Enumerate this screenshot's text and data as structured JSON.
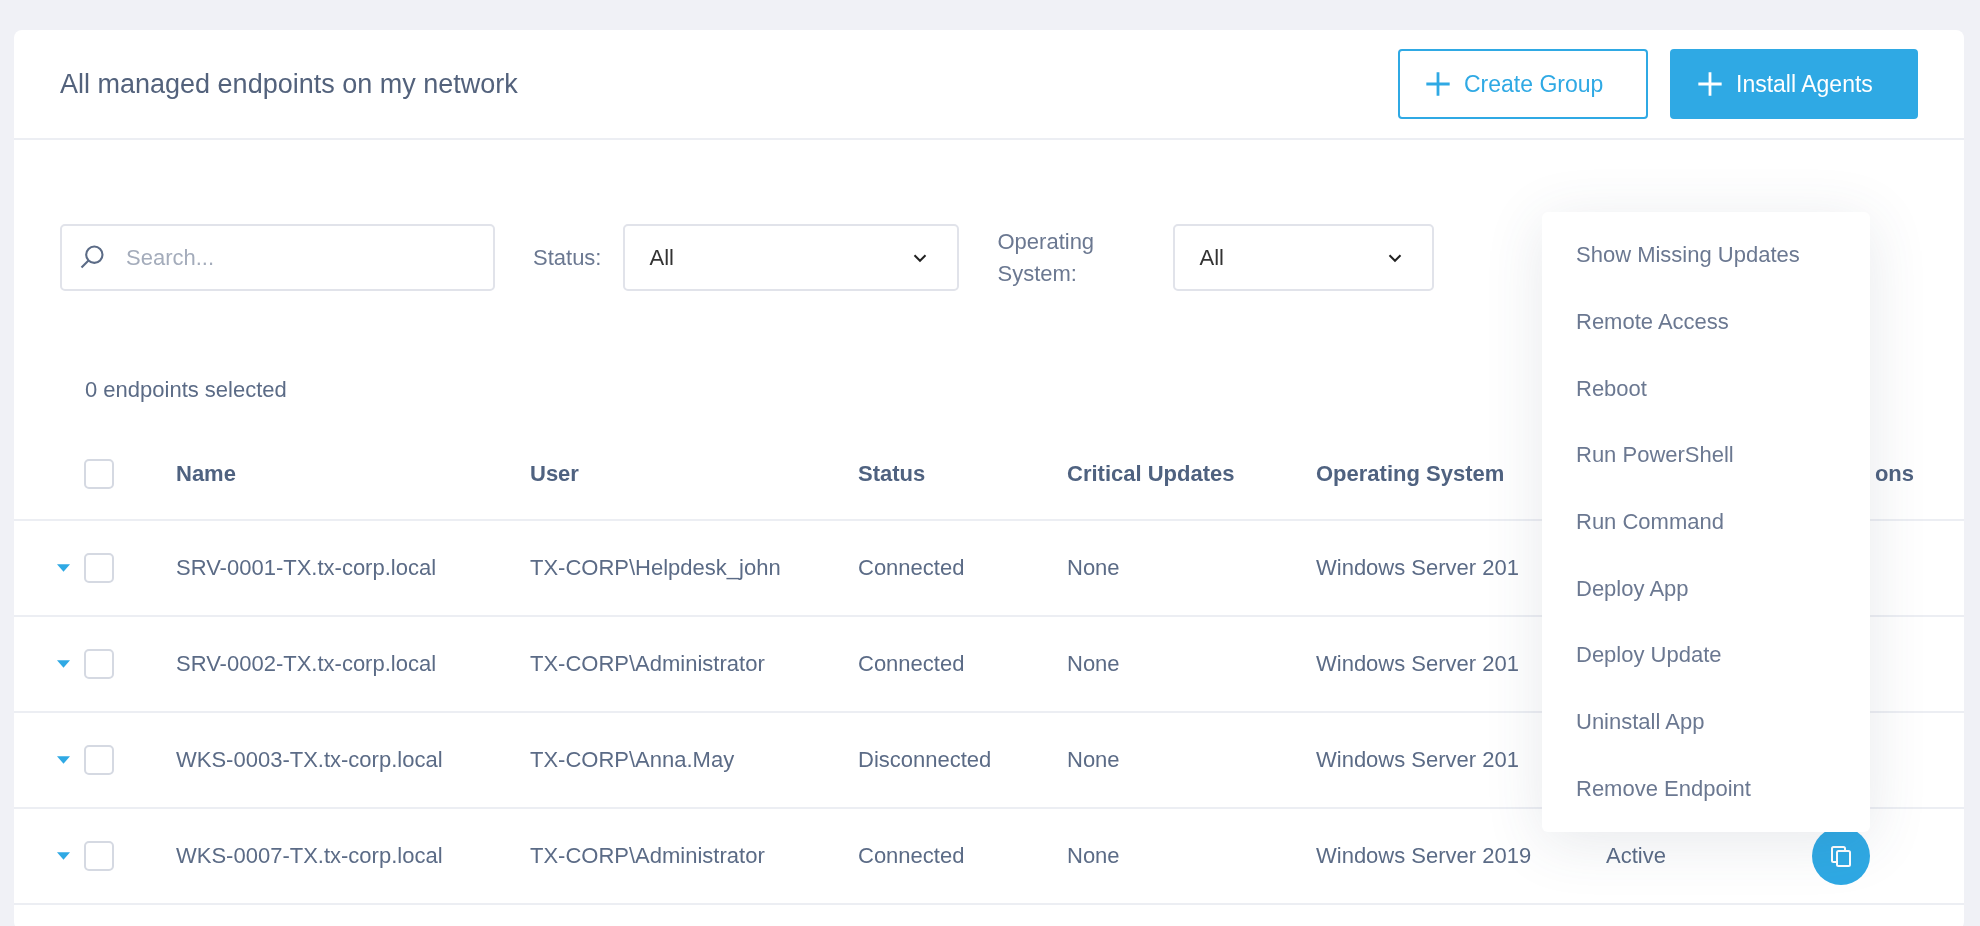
{
  "header": {
    "title": "All managed endpoints on my network",
    "buttons": [
      {
        "label": "Create Group",
        "kind": "outline"
      },
      {
        "label": "Install Agents",
        "kind": "primary"
      }
    ]
  },
  "filters": {
    "search": {
      "placeholder": "Search..."
    },
    "status": {
      "label": "Status:",
      "value": "All"
    },
    "operating_system": {
      "label": "Operating System:",
      "value": "All"
    }
  },
  "selection_count": "0 endpoints selected",
  "table": {
    "select_all": {
      "checked": false
    },
    "columns": [
      {
        "label": "Name"
      },
      {
        "label": "User"
      },
      {
        "label": "Status"
      },
      {
        "label": "Critical Updates"
      },
      {
        "label": "Operating System"
      },
      {
        "label": "ons"
      }
    ],
    "rows": [
      {
        "checked": false,
        "name": "SRV-0001-TX.tx-corp.local",
        "user": "TX-CORP\\Helpdesk_john",
        "status": "Connected",
        "critical_updates": "None",
        "operating_system": "Windows Server 201"
      },
      {
        "checked": false,
        "name": "SRV-0002-TX.tx-corp.local",
        "user": "TX-CORP\\Administrator",
        "status": "Connected",
        "critical_updates": "None",
        "operating_system": "Windows Server 201"
      },
      {
        "checked": false,
        "name": "WKS-0003-TX.tx-corp.local",
        "user": "TX-CORP\\Anna.May",
        "status": "Disconnected",
        "critical_updates": "None",
        "operating_system": "Windows Server 201"
      },
      {
        "checked": false,
        "name": "WKS-0007-TX.tx-corp.local",
        "user": "TX-CORP\\Administrator",
        "status": "Connected",
        "critical_updates": "None",
        "operating_system": "Windows Server 2019",
        "column_6": "Active",
        "action_button": {
          "kind": "copy"
        }
      }
    ]
  },
  "context_menu": {
    "items": [
      "Show Missing Updates",
      "Remote Access",
      "Reboot",
      "Run PowerShell",
      "Run Command",
      "Deploy App",
      "Deploy Update",
      "Uninstall App",
      "Remove Endpoint"
    ]
  }
}
